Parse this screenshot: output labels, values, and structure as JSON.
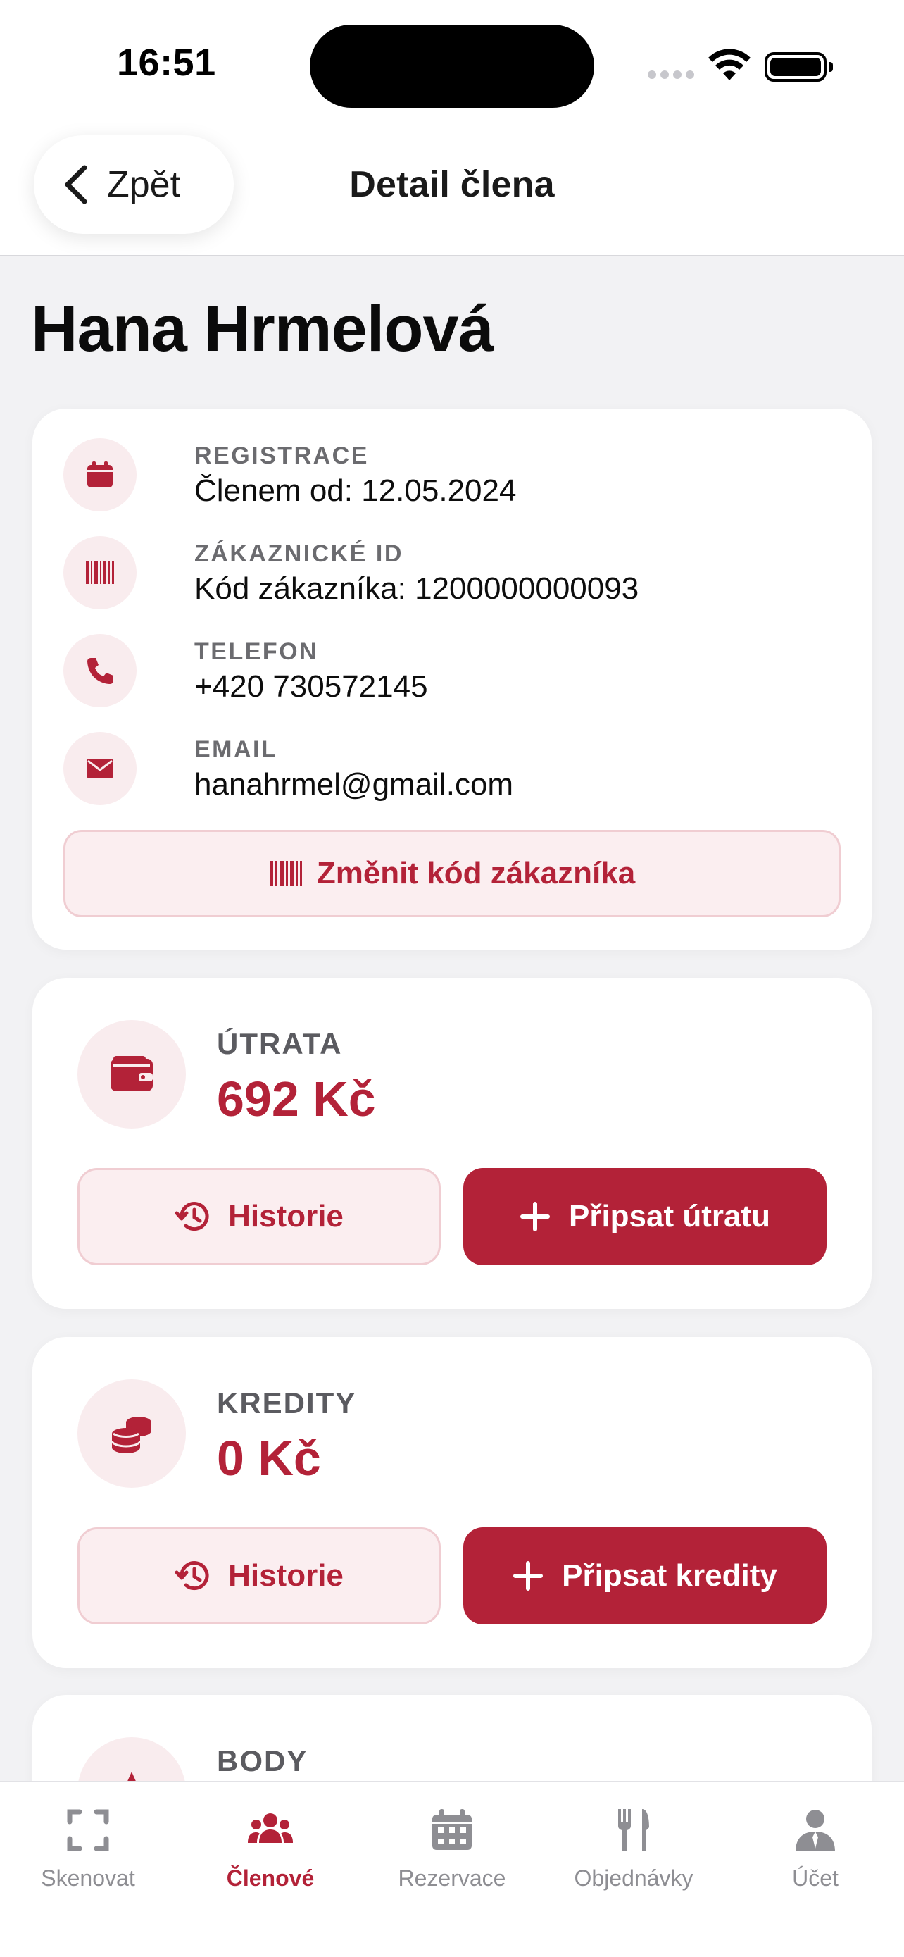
{
  "status_bar": {
    "time": "16:51"
  },
  "header": {
    "back_label": "Zpět",
    "title": "Detail člena"
  },
  "member": {
    "name": "Hana Hrmelová"
  },
  "info": {
    "registration": {
      "label": "REGISTRACE",
      "value": "Členem od: 12.05.2024"
    },
    "customer_id": {
      "label": "ZÁKAZNICKÉ ID",
      "value": "Kód zákazníka: 1200000000093"
    },
    "phone": {
      "label": "TELEFON",
      "value": "+420 730572145"
    },
    "email": {
      "label": "EMAIL",
      "value": "hanahrmel@gmail.com"
    },
    "change_code_label": "Změnit kód zákazníka"
  },
  "spending": {
    "label": "ÚTRATA",
    "value": "692 Kč",
    "history_label": "Historie",
    "add_label": "Připsat útratu"
  },
  "credits": {
    "label": "KREDITY",
    "value": "0 Kč",
    "history_label": "Historie",
    "add_label": "Připsat kredity"
  },
  "points": {
    "label": "BODY"
  },
  "tabbar": {
    "items": [
      {
        "label": "Skenovat",
        "icon": "scan-icon"
      },
      {
        "label": "Členové",
        "icon": "members-icon",
        "active": true
      },
      {
        "label": "Rezervace",
        "icon": "calendar-icon"
      },
      {
        "label": "Objednávky",
        "icon": "utensils-icon"
      },
      {
        "label": "Účet",
        "icon": "account-icon"
      }
    ]
  },
  "colors": {
    "accent": "#b32238",
    "accent_light": "#f9ecee",
    "tab_inactive": "#8e8e93"
  }
}
